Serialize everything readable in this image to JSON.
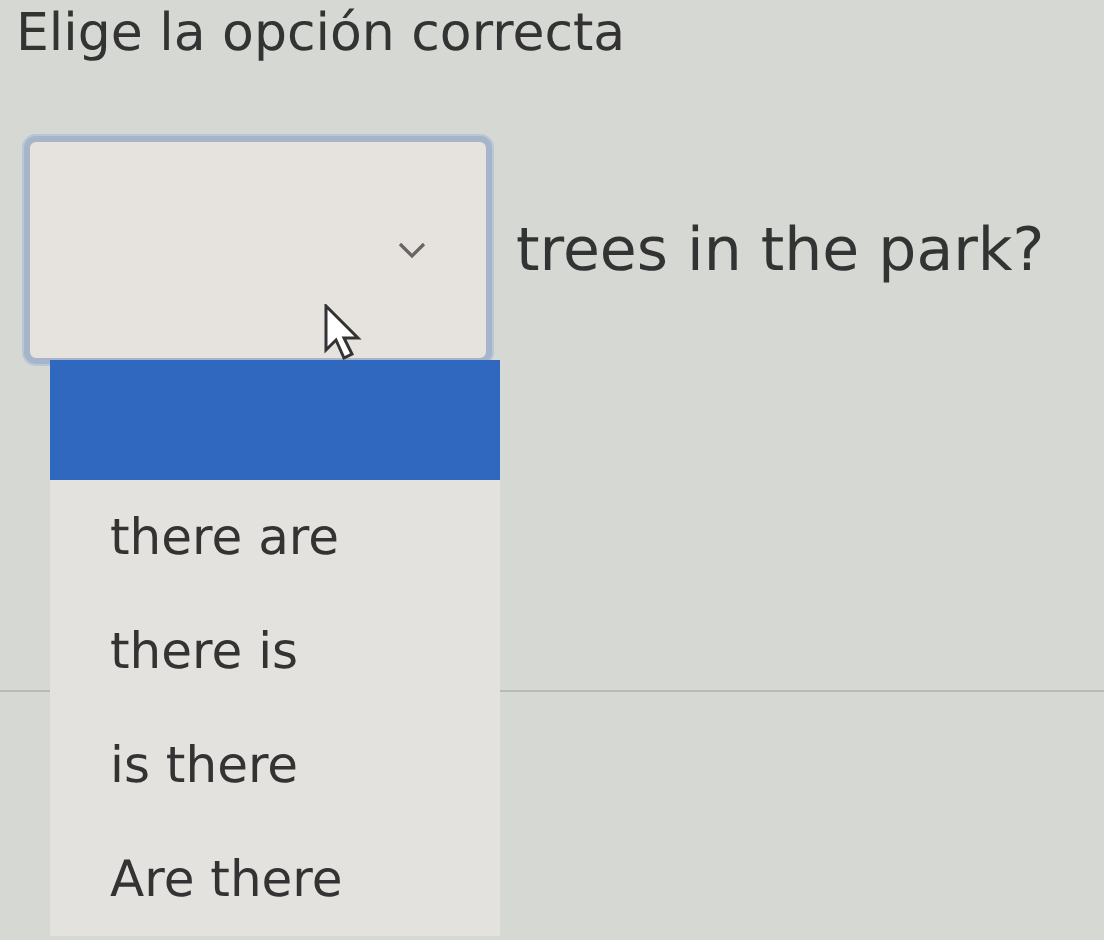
{
  "title": "Elige la opción correcta",
  "question": {
    "after_text": "trees in the park?",
    "expanded": true
  },
  "options": [
    {
      "selected": true
    },
    {
      "label": "there are",
      "selected": false
    },
    {
      "label": "there is",
      "selected": false
    },
    {
      "label": "is there",
      "selected": false
    },
    {
      "label": "Are there",
      "selected": false
    }
  ]
}
